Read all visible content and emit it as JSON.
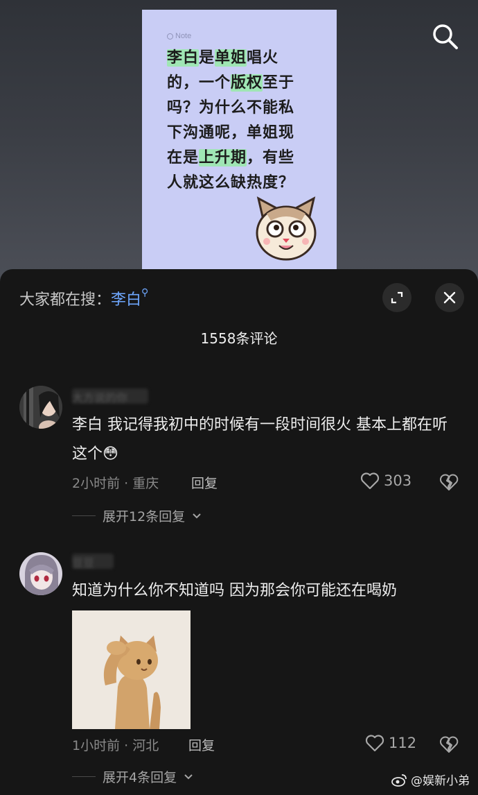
{
  "video": {
    "note_tag": "Note",
    "note_lines": [
      [
        {
          "t": "李白",
          "h": true
        },
        {
          "t": "是",
          "h": false
        },
        {
          "t": "单姐",
          "h": true
        },
        {
          "t": "唱火",
          "h": false
        }
      ],
      [
        {
          "t": "的，一个",
          "h": false
        },
        {
          "t": "版权",
          "h": true
        },
        {
          "t": "至于",
          "h": false
        }
      ],
      [
        {
          "t": "吗？为什么不能私",
          "h": false
        }
      ],
      [
        {
          "t": "下沟通呢，单姐现",
          "h": false
        }
      ],
      [
        {
          "t": "在是",
          "h": false
        },
        {
          "t": "上升期",
          "h": true
        },
        {
          "t": "，有些",
          "h": false
        }
      ],
      [
        {
          "t": "人就这么缺热度？",
          "h": false
        }
      ]
    ],
    "search_icon": "search-icon"
  },
  "sheet": {
    "search_prefix": "大家都在搜：",
    "search_keyword": "李白",
    "expand_icon": "expand-icon",
    "close_icon": "close-icon",
    "comment_count": "1558条评论"
  },
  "comments": [
    {
      "username": "大方说的你",
      "text": "李白 我记得我初中的时候有一段时间很火 基本上都在听这个",
      "emoji": "😳",
      "time_location": "2小时前 · 重庆",
      "reply_label": "回复",
      "likes": "303",
      "expand_replies": "展开12条回复"
    },
    {
      "username": "豆豆",
      "text": "知道为什么你不知道吗 因为那会你可能还在喝奶",
      "time_location": "1小时前 · 河北",
      "reply_label": "回复",
      "likes": "112",
      "expand_replies": "展开4条回复"
    }
  ],
  "watermark": "@娱新小弟",
  "colors": {
    "accent_blue": "#6fa8ff",
    "sheet_bg": "#161616",
    "note_bg": "#c9cdf5",
    "highlight_green": "#9fe6b4"
  }
}
